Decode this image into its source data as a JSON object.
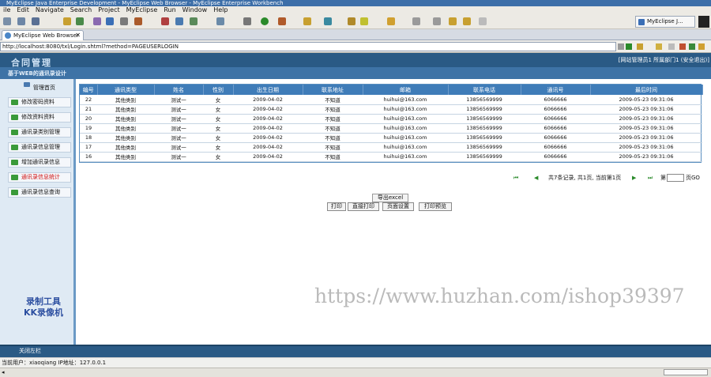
{
  "window": {
    "title": "MyEclipse Java Enterprise Development - MyEclipse Web Browser - MyEclipse Enterprise Workbench"
  },
  "menu": [
    "ile",
    "Edit",
    "Navigate",
    "Search",
    "Project",
    "MyEclipse",
    "Run",
    "Window",
    "Help"
  ],
  "perspective": {
    "label": "MyEclipse J..."
  },
  "tab": {
    "label": "MyEclipse Web Browser",
    "close": "✕"
  },
  "url": {
    "value": "http://localhost:8080/txl/Login.shtml?method=PAGEUSERLOGIN"
  },
  "app": {
    "logo": "合同管理",
    "user_info": "[网站管理员1 所属部门1 (安全退出)]",
    "subtitle": "基于WEB的通讯录设计"
  },
  "sidebar": {
    "header": "管理首页",
    "items": [
      {
        "label": "修改密码资料",
        "active": false
      },
      {
        "label": "修改资料资料",
        "active": false
      },
      {
        "label": "通讯录类别管理",
        "active": false
      },
      {
        "label": "通讯录信息管理",
        "active": false
      },
      {
        "label": "增加通讯录信息",
        "active": false
      },
      {
        "label": "通讯录信息统计",
        "active": true
      },
      {
        "label": "通讯录信息查询",
        "active": false
      }
    ]
  },
  "table": {
    "columns": [
      "编号",
      "通讯类型",
      "姓名",
      "性别",
      "出生日期",
      "联系地址",
      "邮箱",
      "联系电话",
      "通讯号",
      "最后时间"
    ],
    "rows": [
      [
        "22",
        "其他类别",
        "测试一",
        "女",
        "2009-04-02",
        "不知道",
        "huihui@163.com",
        "13856569999",
        "6066666",
        "2009-05-23 09:31:06"
      ],
      [
        "21",
        "其他类别",
        "测试一",
        "女",
        "2009-04-02",
        "不知道",
        "huihui@163.com",
        "13856569999",
        "6066666",
        "2009-05-23 09:31:06"
      ],
      [
        "20",
        "其他类别",
        "测试一",
        "女",
        "2009-04-02",
        "不知道",
        "huihui@163.com",
        "13856569999",
        "6066666",
        "2009-05-23 09:31:06"
      ],
      [
        "19",
        "其他类别",
        "测试一",
        "女",
        "2009-04-02",
        "不知道",
        "huihui@163.com",
        "13856569999",
        "6066666",
        "2009-05-23 09:31:06"
      ],
      [
        "18",
        "其他类别",
        "测试一",
        "女",
        "2009-04-02",
        "不知道",
        "huihui@163.com",
        "13856569999",
        "6066666",
        "2009-05-23 09:31:06"
      ],
      [
        "17",
        "其他类别",
        "测试一",
        "女",
        "2009-04-02",
        "不知道",
        "huihui@163.com",
        "13856569999",
        "6066666",
        "2009-05-23 09:31:06"
      ],
      [
        "16",
        "其他类别",
        "测试一",
        "女",
        "2009-04-02",
        "不知道",
        "huihui@163.com",
        "13856569999",
        "6066666",
        "2009-05-23 09:31:06"
      ]
    ]
  },
  "pager": {
    "info": "共7条记录, 共1页, 当前第1页",
    "page_prefix": "第",
    "page_value": "",
    "go": "页GO"
  },
  "actions": {
    "export": "导出excel",
    "print": "打印",
    "direct_print": "直接打印",
    "page_setup": "页面设置",
    "print_preview": "打印预览"
  },
  "watermark": "https://www.huzhan.com/ishop39397",
  "recorder": {
    "line1": "录制工具",
    "line2": "KK录像机"
  },
  "footer": {
    "close_nav": "关闭左栏"
  },
  "status": {
    "text": "当前用户：xiaoqiang  IP地址：127.0.0.1"
  },
  "colors": {
    "header_blue": "#2a5a85",
    "table_header": "#3f7cb8",
    "active_item": "#d01010"
  }
}
